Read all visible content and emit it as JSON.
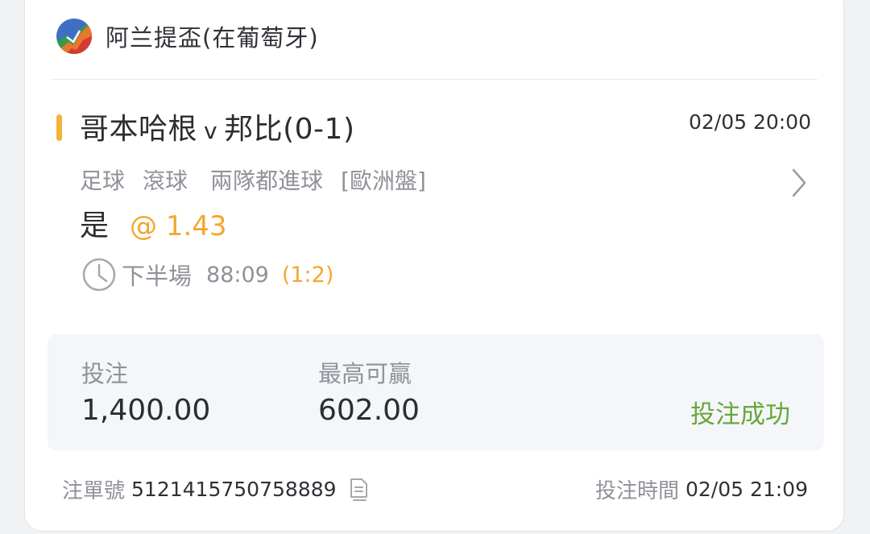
{
  "league": {
    "name": "阿兰提盃(在葡萄牙)",
    "logo_icon": "league-logo-icon"
  },
  "match": {
    "home": "哥本哈根",
    "vs": "v",
    "away_with_handicap": "邦比(0-1)",
    "start_time": "02/05 20:00"
  },
  "market": {
    "sport": "足球",
    "type": "滾球",
    "bet_type": "兩隊都進球",
    "odds_format": "[歐洲盤]"
  },
  "pick": {
    "selection": "是",
    "odds": "@ 1.43"
  },
  "live_status": {
    "period": "下半場",
    "clock": "88:09",
    "score": "(1:2)"
  },
  "stake_panel": {
    "stake_label": "投注",
    "stake_value": "1,400.00",
    "max_win_label": "最高可贏",
    "max_win_value": "602.00",
    "status": "投注成功"
  },
  "footer": {
    "ticket_label": "注單號",
    "ticket_number": "5121415750758889",
    "placed_time_label": "投注時間",
    "placed_time": "02/05 21:09"
  },
  "colors": {
    "accent": "#f5b335",
    "odds": "#f3a72d",
    "success": "#67a83a",
    "muted_text": "#8f9298",
    "primary_text": "#2b2d31"
  }
}
